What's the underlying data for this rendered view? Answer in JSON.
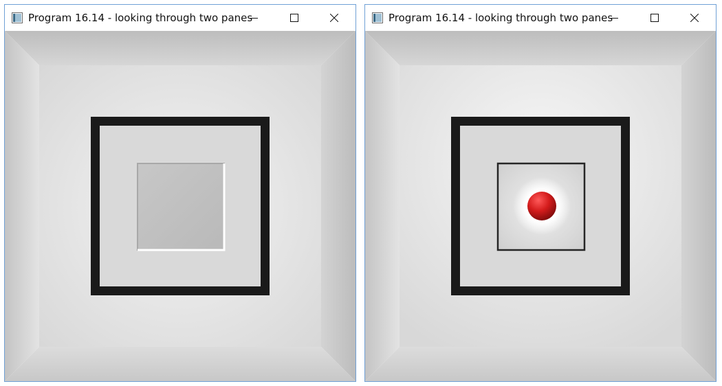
{
  "windows": [
    {
      "title": "Program 16.14 - looking through two panes",
      "icon": "app-window-icon",
      "controls": [
        "minimize-icon",
        "maximize-icon",
        "close-icon"
      ],
      "scene": {
        "description_free": true,
        "inner_pane": "translucent",
        "object_visible": false
      }
    },
    {
      "title": "Program 16.14 - looking through two panes",
      "icon": "app-window-icon",
      "controls": [
        "minimize-icon",
        "maximize-icon",
        "close-icon"
      ],
      "scene": {
        "inner_pane": "clear",
        "object_visible": true,
        "object_color": "#d21a1a"
      }
    }
  ],
  "colors": {
    "frame": "#1a1a1a",
    "window_border": "#6fa0d6"
  }
}
